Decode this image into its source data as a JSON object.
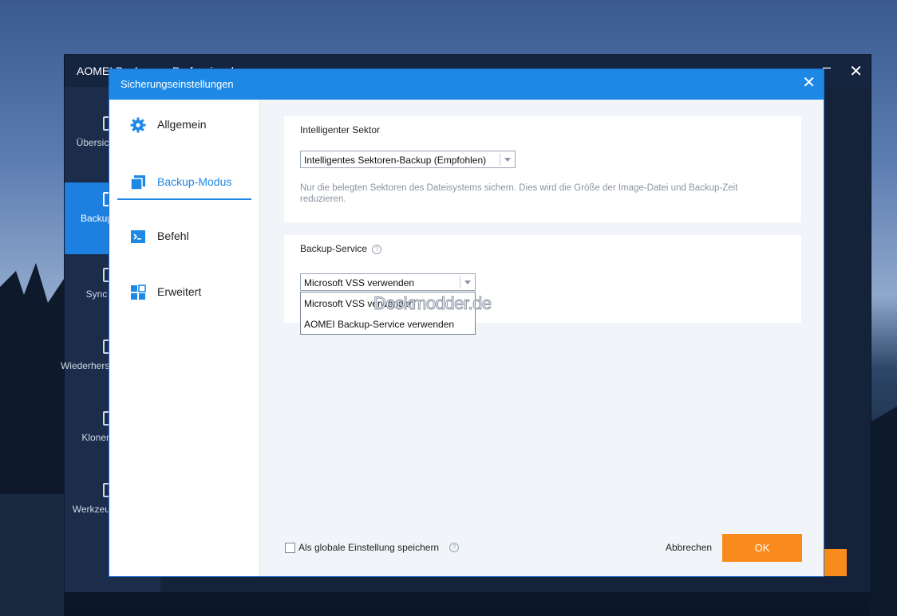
{
  "app": {
    "title": "AOMEI Backupper Professional",
    "sidebar": [
      {
        "label": "Übersicht",
        "icon": "home-icon"
      },
      {
        "label": "Backup",
        "icon": "backup-icon",
        "active": true
      },
      {
        "label": "Sync",
        "icon": "sync-icon"
      },
      {
        "label": "Wiederherstellen",
        "icon": "restore-icon"
      },
      {
        "label": "Klonen",
        "icon": "clone-icon"
      },
      {
        "label": "Werkzeuge",
        "icon": "tools-icon"
      }
    ]
  },
  "dialog": {
    "title": "Sicherungseinstellungen",
    "nav": [
      {
        "label": "Allgemein",
        "icon": "gear-icon"
      },
      {
        "label": "Backup-Modus",
        "icon": "backup-mode-icon",
        "active": true
      },
      {
        "label": "Befehl",
        "icon": "terminal-icon"
      },
      {
        "label": "Erweitert",
        "icon": "grid-icon"
      }
    ],
    "sector": {
      "title": "Intelligenter Sektor",
      "selected": "Intelligentes Sektoren-Backup (Empfohlen)",
      "description": "Nur die belegten Sektoren des Dateisystems sichern. Dies wird die Größe der Image-Datei und Backup-Zeit reduzieren."
    },
    "service": {
      "title": "Backup-Service",
      "selected": "Microsoft VSS verwenden",
      "options": [
        "Microsoft VSS verwenden",
        "AOMEI Backup-Service verwenden"
      ]
    },
    "footer": {
      "global_label": "Als globale Einstellung speichern",
      "cancel": "Abbrechen",
      "ok": "OK"
    },
    "watermark": "Deskmodder.de"
  },
  "colors": {
    "accent": "#1e88e5",
    "ok_button": "#f98b1c",
    "dialog_bg": "#f1f4f8"
  }
}
